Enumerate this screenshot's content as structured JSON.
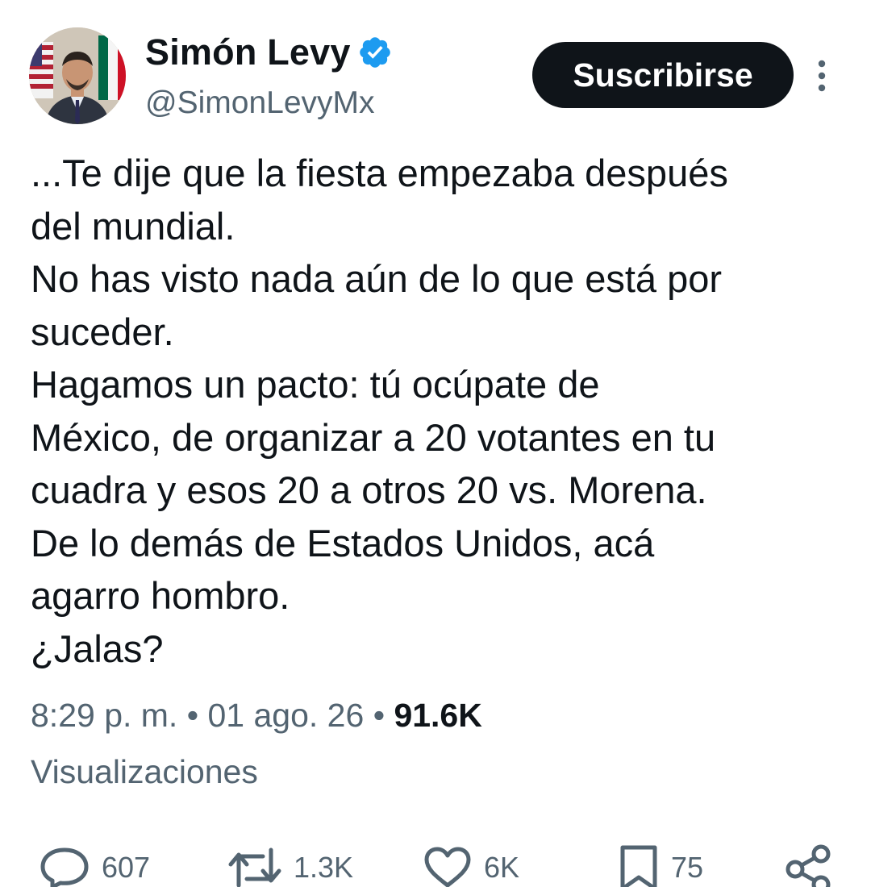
{
  "user": {
    "display_name": "Simón Levy",
    "handle": "@SimonLevyMx"
  },
  "header": {
    "subscribe_label": "Suscribirse",
    "verified_icon": "verified-badge-icon",
    "more_icon": "more-vertical-icon"
  },
  "tweet": {
    "lines": [
      "...Te dije que la fiesta empezaba después",
      "del mundial.",
      "No has visto nada aún de lo que está por",
      "suceder.",
      "Hagamos un pacto: tú ocúpate de",
      "México, de organizar a 20 votantes en tu",
      "cuadra y esos 20 a otros 20 vs. Morena.",
      "De lo demás de Estados Unidos, acá",
      "agarro hombro.",
      "¿Jalas?"
    ]
  },
  "meta": {
    "time": "8:29 p. m.",
    "separator": "•",
    "date": "01 ago. 26",
    "views_count": "91.6K",
    "views_label": "Visualizaciones"
  },
  "actions": {
    "replies": "607",
    "retweets": "1.3K",
    "likes": "6K",
    "bookmarks": "75"
  },
  "colors": {
    "text": "#0f1419",
    "secondary": "#536471",
    "verified": "#1d9bf0",
    "button_bg": "#0f1419"
  }
}
